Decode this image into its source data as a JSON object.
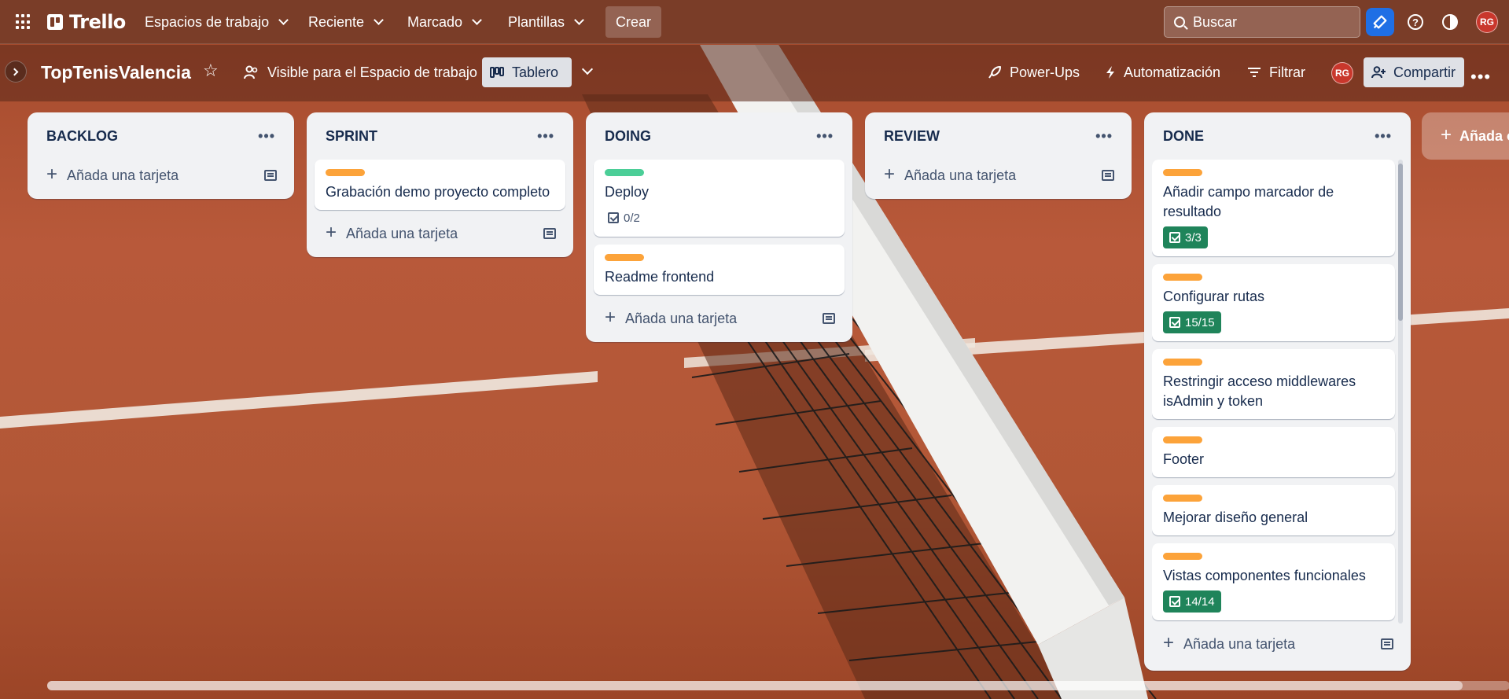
{
  "app": {
    "brand": "Trello"
  },
  "topbar": {
    "nav": [
      {
        "label": "Espacios de trabajo"
      },
      {
        "label": "Reciente"
      },
      {
        "label": "Marcado"
      },
      {
        "label": "Plantillas"
      }
    ],
    "create_label": "Crear",
    "search_placeholder": "Buscar",
    "user_initials": "RG",
    "colors": {
      "bar": "#7a3d28",
      "notif": "#1f6fe5",
      "avatar": "#c9372c"
    }
  },
  "board": {
    "title": "TopTenisValencia",
    "visibility_label": "Visible para el Espacio de trabajo",
    "view_label": "Tablero",
    "powerups_label": "Power-Ups",
    "automation_label": "Automatización",
    "filter_label": "Filtrar",
    "share_label": "Compartir",
    "member_initials": "RG",
    "add_list_label": "Añada o"
  },
  "lists": [
    {
      "title": "BACKLOG",
      "add_card_label": "Añada una tarjeta",
      "cards": []
    },
    {
      "title": "SPRINT",
      "add_card_label": "Añada una tarjeta",
      "cards": [
        {
          "label_color": "#fca33a",
          "title": "Grabación demo proyecto completo",
          "checklist": null
        }
      ]
    },
    {
      "title": "DOING",
      "add_card_label": "Añada una tarjeta",
      "cards": [
        {
          "label_color": "#4bce97",
          "title": "Deploy",
          "checklist": "0/2",
          "checklist_complete": false
        },
        {
          "label_color": "#fca33a",
          "title": "Readme frontend",
          "checklist": null
        }
      ]
    },
    {
      "title": "REVIEW",
      "add_card_label": "Añada una tarjeta",
      "cards": []
    },
    {
      "title": "DONE",
      "add_card_label": "Añada una tarjeta",
      "cards": [
        {
          "label_color": "#fca33a",
          "title": "Añadir campo marcador de resultado",
          "checklist": "3/3",
          "checklist_complete": true
        },
        {
          "label_color": "#fca33a",
          "title": "Configurar rutas",
          "checklist": "15/15",
          "checklist_complete": true
        },
        {
          "label_color": "#fca33a",
          "title": "Restringir acceso middlewares isAdmin y token",
          "checklist": null
        },
        {
          "label_color": "#fca33a",
          "title": "Footer",
          "checklist": null
        },
        {
          "label_color": "#fca33a",
          "title": "Mejorar diseño general",
          "checklist": null
        },
        {
          "label_color": "#fca33a",
          "title": "Vistas componentes funcionales",
          "checklist": "14/14",
          "checklist_complete": true
        },
        {
          "label_color": "#fca33a",
          "title": "",
          "checklist": null
        }
      ]
    }
  ]
}
